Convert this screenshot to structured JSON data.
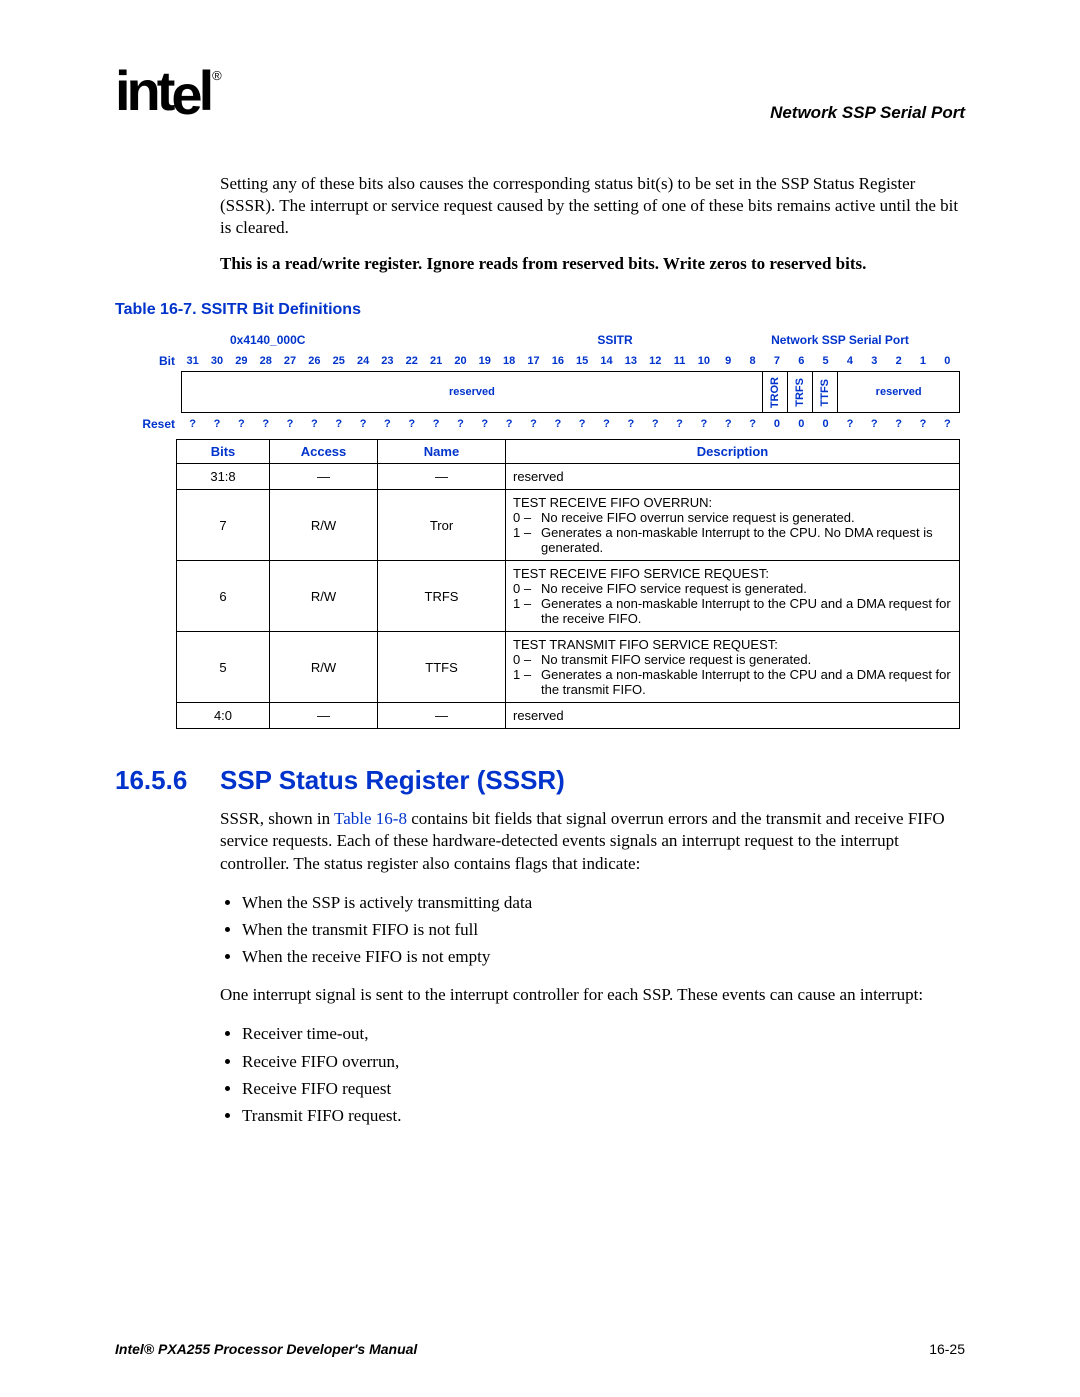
{
  "header": {
    "logo_text": "intel",
    "reg_mark": "®",
    "chapter": "Network SSP Serial Port"
  },
  "intro": {
    "p1": "Setting any of these bits also causes the corresponding status bit(s) to be set in the SSP Status Register (SSSR). The interrupt or service request caused by the setting of one of these bits remains active until the bit is cleared.",
    "p2": "This is a read/write register. Ignore reads from reserved bits. Write zeros to reserved bits."
  },
  "table": {
    "caption": "Table 16-7. SSITR Bit Definitions",
    "addr": "0x4140_000C",
    "reg": "SSITR",
    "port": "Network SSP Serial Port",
    "label_bit": "Bit",
    "label_reset": "Reset",
    "bit_numbers": [
      "31",
      "30",
      "29",
      "28",
      "27",
      "26",
      "25",
      "24",
      "23",
      "22",
      "21",
      "20",
      "19",
      "18",
      "17",
      "16",
      "15",
      "14",
      "13",
      "12",
      "11",
      "10",
      "9",
      "8",
      "7",
      "6",
      "5",
      "4",
      "3",
      "2",
      "1",
      "0"
    ],
    "fields": [
      {
        "span": 24,
        "label": "reserved",
        "vertical": false
      },
      {
        "span": 1,
        "label": "TROR",
        "vertical": true
      },
      {
        "span": 1,
        "label": "TRFS",
        "vertical": true
      },
      {
        "span": 1,
        "label": "TTFS",
        "vertical": true
      },
      {
        "span": 5,
        "label": "reserved",
        "vertical": false
      }
    ],
    "reset": [
      "?",
      "?",
      "?",
      "?",
      "?",
      "?",
      "?",
      "?",
      "?",
      "?",
      "?",
      "?",
      "?",
      "?",
      "?",
      "?",
      "?",
      "?",
      "?",
      "?",
      "?",
      "?",
      "?",
      "?",
      "0",
      "0",
      "0",
      "?",
      "?",
      "?",
      "?",
      "?"
    ],
    "columns": {
      "bits": "Bits",
      "access": "Access",
      "name": "Name",
      "desc": "Description"
    },
    "rows": [
      {
        "bits": "31:8",
        "access": "—",
        "name": "—",
        "desc_title": "",
        "desc_lines": [
          {
            "k": "",
            "v": "reserved"
          }
        ]
      },
      {
        "bits": "7",
        "access": "R/W",
        "name": "Tror",
        "desc_title": "TEST RECEIVE FIFO OVERRUN:",
        "desc_lines": [
          {
            "k": "0 –",
            "v": "No receive FIFO overrun service request is generated."
          },
          {
            "k": "1 –",
            "v": "Generates a non-maskable Interrupt to the CPU. No DMA request is generated."
          }
        ]
      },
      {
        "bits": "6",
        "access": "R/W",
        "name": "TRFS",
        "desc_title": "TEST RECEIVE FIFO SERVICE REQUEST:",
        "desc_lines": [
          {
            "k": "0 –",
            "v": "No receive FIFO service request is generated."
          },
          {
            "k": "1 –",
            "v": "Generates a non-maskable Interrupt to the CPU and a DMA request for the receive FIFO."
          }
        ]
      },
      {
        "bits": "5",
        "access": "R/W",
        "name": "TTFS",
        "desc_title": "TEST TRANSMIT FIFO SERVICE REQUEST:",
        "desc_lines": [
          {
            "k": "0 –",
            "v": "No transmit FIFO service request is generated."
          },
          {
            "k": "1 –",
            "v": "Generates a non-maskable Interrupt to the CPU and a DMA request for the transmit FIFO."
          }
        ]
      },
      {
        "bits": "4:0",
        "access": "—",
        "name": "—",
        "desc_title": "",
        "desc_lines": [
          {
            "k": "",
            "v": "reserved"
          }
        ]
      }
    ]
  },
  "section": {
    "num": "16.5.6",
    "title": "SSP Status Register (SSSR)",
    "p1a": "SSSR, shown in ",
    "link": "Table 16-8",
    "p1b": " contains bit fields that signal overrun errors and the transmit and receive FIFO service requests. Each of these hardware-detected events signals an interrupt request to the interrupt controller. The status register also contains flags that indicate:",
    "list1": [
      "When the SSP is actively transmitting data",
      "When the transmit FIFO is not full",
      "When the receive FIFO is not empty"
    ],
    "p2": "One interrupt signal is sent to the interrupt controller for each SSP. These events can cause an interrupt:",
    "list2": [
      "Receiver time-out,",
      "Receive FIFO overrun,",
      "Receive FIFO request",
      "Transmit FIFO request."
    ]
  },
  "footer": {
    "title": "Intel® PXA255 Processor Developer's Manual",
    "page": "16-25"
  }
}
